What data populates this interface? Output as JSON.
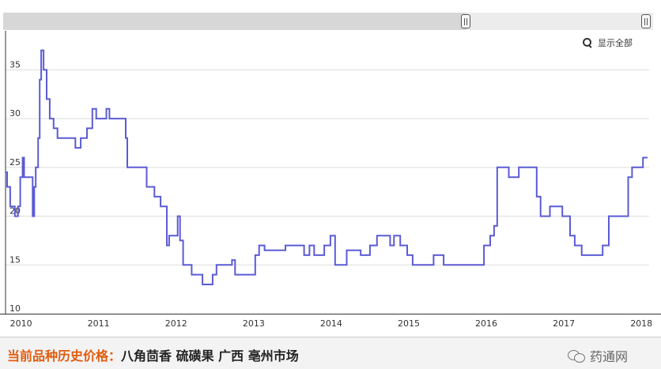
{
  "controls": {
    "show_all_label": "显示全部"
  },
  "footer": {
    "label": "当前品种历史价格：",
    "item": "八角茴香 硫磺果 广西 亳州市场",
    "watermark": "药通网"
  },
  "colors": {
    "line": "#5b5bd6",
    "grid": "#dddddd",
    "label_orange": "#e25c0d"
  },
  "chart_data": {
    "type": "line",
    "step": true,
    "title": "",
    "xlabel": "",
    "ylabel": "",
    "xlim": [
      2009.8,
      2018.1
    ],
    "ylim": [
      10,
      39
    ],
    "yticks": [
      10,
      15,
      20,
      25,
      30,
      35
    ],
    "xticks": [
      2010,
      2011,
      2012,
      2013,
      2014,
      2015,
      2016,
      2017,
      2018
    ],
    "grid": true,
    "legend": "none",
    "series": [
      {
        "values": [
          [
            2009.8,
            24.5
          ],
          [
            2009.82,
            23
          ],
          [
            2009.86,
            21
          ],
          [
            2009.92,
            20
          ],
          [
            2009.96,
            21
          ],
          [
            2009.99,
            24
          ],
          [
            2010.02,
            26
          ],
          [
            2010.04,
            24
          ],
          [
            2010.13,
            24
          ],
          [
            2010.15,
            20
          ],
          [
            2010.17,
            23
          ],
          [
            2010.19,
            25
          ],
          [
            2010.22,
            28
          ],
          [
            2010.24,
            34
          ],
          [
            2010.26,
            37
          ],
          [
            2010.29,
            35
          ],
          [
            2010.33,
            32
          ],
          [
            2010.37,
            30
          ],
          [
            2010.42,
            29
          ],
          [
            2010.47,
            28
          ],
          [
            2010.7,
            27
          ],
          [
            2010.77,
            28
          ],
          [
            2010.85,
            29
          ],
          [
            2010.92,
            31
          ],
          [
            2010.97,
            30
          ],
          [
            2011.1,
            31
          ],
          [
            2011.14,
            30
          ],
          [
            2011.35,
            28
          ],
          [
            2011.37,
            25
          ],
          [
            2011.62,
            23
          ],
          [
            2011.72,
            22
          ],
          [
            2011.8,
            21
          ],
          [
            2011.88,
            17
          ],
          [
            2011.91,
            18
          ],
          [
            2012.02,
            20
          ],
          [
            2012.05,
            17.5
          ],
          [
            2012.09,
            15
          ],
          [
            2012.2,
            14
          ],
          [
            2012.34,
            13
          ],
          [
            2012.47,
            14
          ],
          [
            2012.52,
            15
          ],
          [
            2012.72,
            15.5
          ],
          [
            2012.76,
            14
          ],
          [
            2013.02,
            16
          ],
          [
            2013.07,
            17
          ],
          [
            2013.14,
            16.5
          ],
          [
            2013.29,
            16.5
          ],
          [
            2013.41,
            17
          ],
          [
            2013.65,
            16
          ],
          [
            2013.72,
            17
          ],
          [
            2013.78,
            16
          ],
          [
            2013.91,
            17
          ],
          [
            2013.99,
            18
          ],
          [
            2014.05,
            15
          ],
          [
            2014.2,
            16.5
          ],
          [
            2014.38,
            16
          ],
          [
            2014.5,
            17
          ],
          [
            2014.59,
            18
          ],
          [
            2014.76,
            17
          ],
          [
            2014.81,
            18
          ],
          [
            2014.89,
            17
          ],
          [
            2014.98,
            16
          ],
          [
            2015.05,
            15
          ],
          [
            2015.32,
            16
          ],
          [
            2015.45,
            15
          ],
          [
            2015.97,
            17
          ],
          [
            2016.05,
            18
          ],
          [
            2016.1,
            19
          ],
          [
            2016.14,
            25
          ],
          [
            2016.29,
            24
          ],
          [
            2016.42,
            25
          ],
          [
            2016.65,
            22
          ],
          [
            2016.7,
            20
          ],
          [
            2016.82,
            21
          ],
          [
            2016.98,
            20
          ],
          [
            2017.08,
            18
          ],
          [
            2017.14,
            17
          ],
          [
            2017.23,
            16
          ],
          [
            2017.5,
            17
          ],
          [
            2017.58,
            20
          ],
          [
            2017.83,
            24
          ],
          [
            2017.88,
            25
          ],
          [
            2018.02,
            26
          ],
          [
            2018.08,
            26
          ]
        ]
      }
    ]
  }
}
